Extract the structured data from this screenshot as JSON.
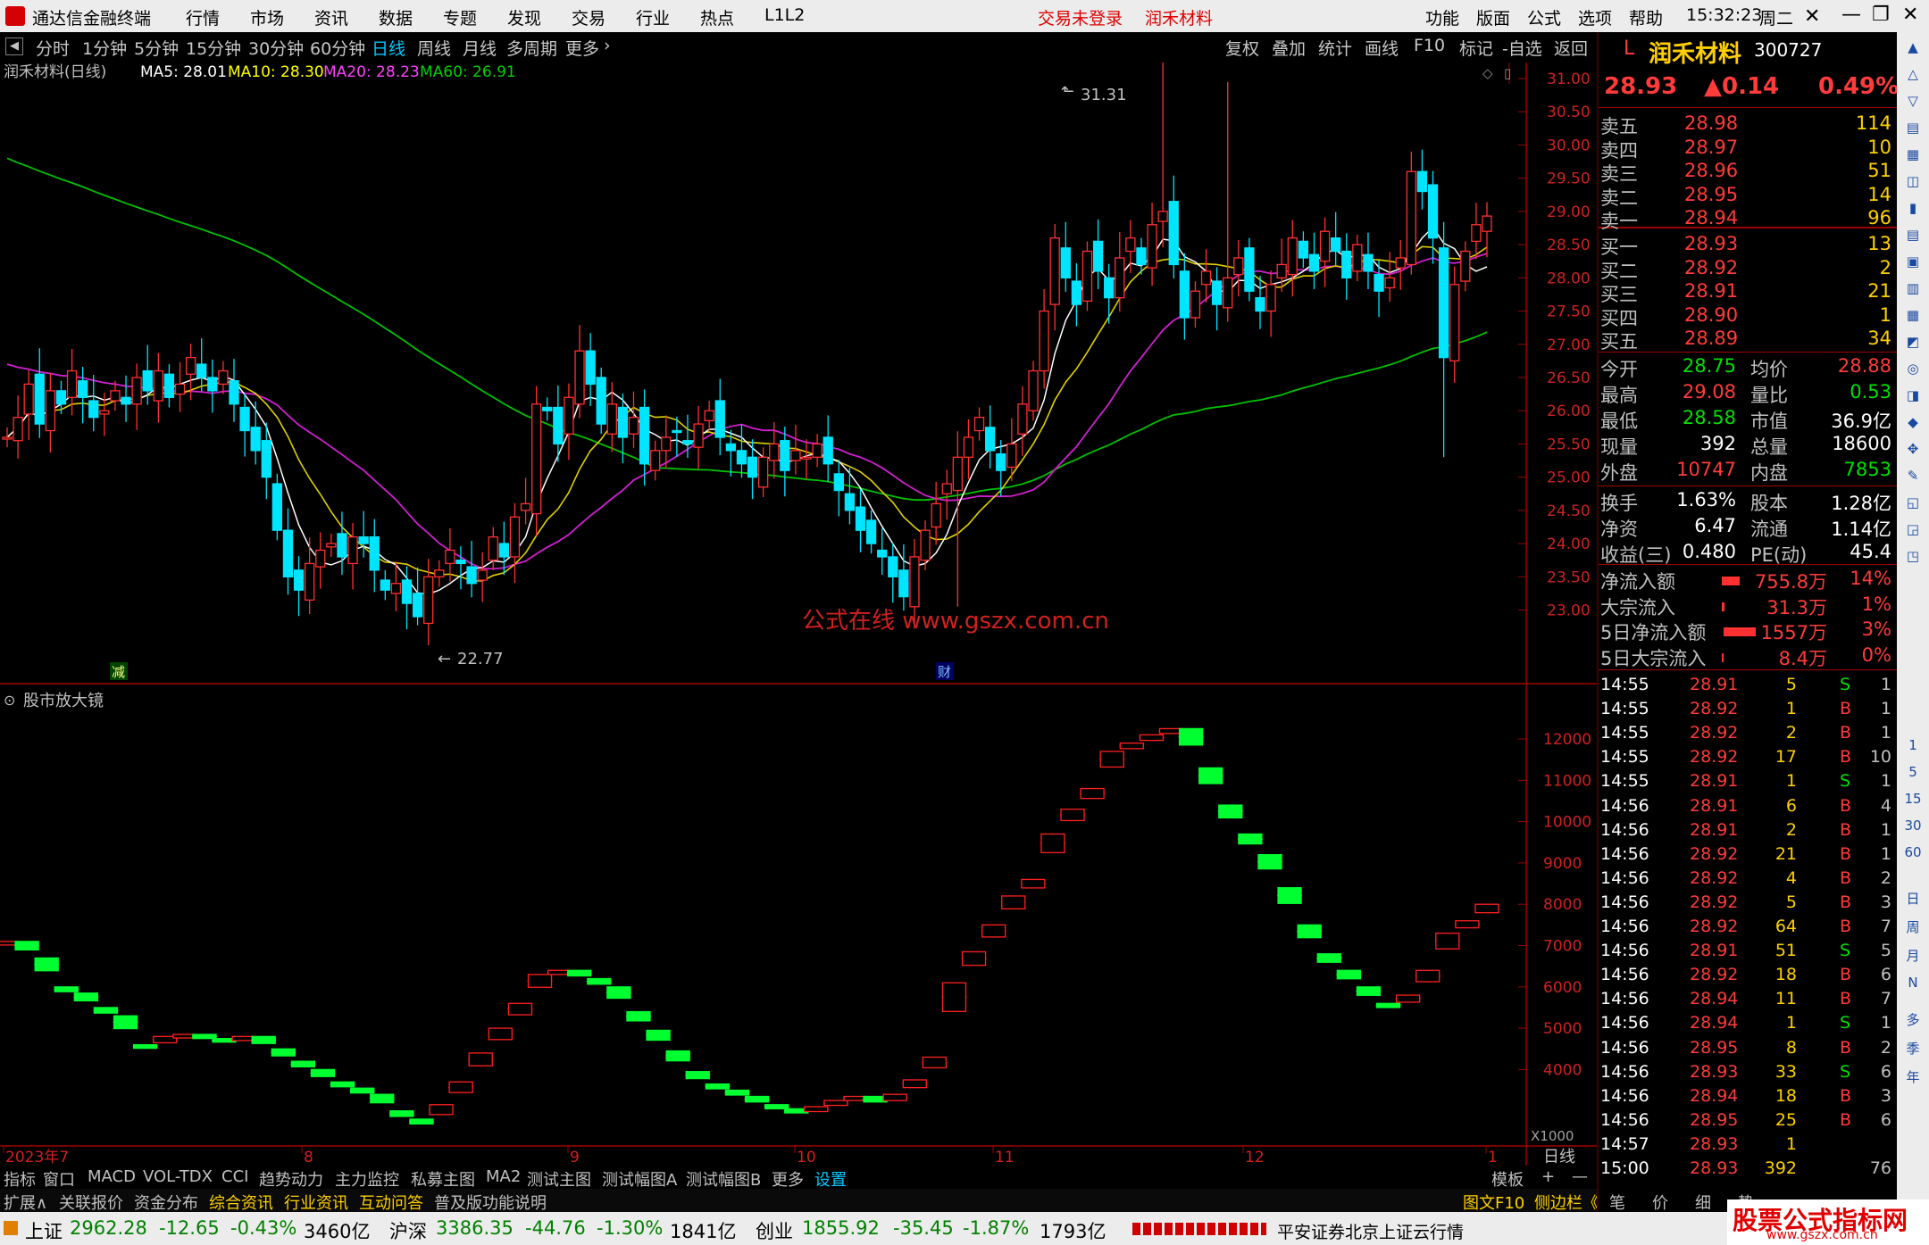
{
  "title": {
    "app": "通达信金融终端",
    "menus": [
      "行情",
      "市场",
      "资讯",
      "数据",
      "专题",
      "发现",
      "交易",
      "行业",
      "热点",
      "L1L2"
    ],
    "status_not_logged": "交易未登录",
    "stock": "润禾材料",
    "right_menus": [
      "功能",
      "版面",
      "公式",
      "选项",
      "帮助"
    ],
    "time": "15:32:23",
    "weekday": "周二"
  },
  "periods": [
    "分时",
    "1分钟",
    "5分钟",
    "15分钟",
    "30分钟",
    "60分钟",
    "日线",
    "周线",
    "月线",
    "多周期",
    "更多"
  ],
  "chart_tools": [
    "复权",
    "叠加",
    "统计",
    "画线",
    "F10",
    "标记",
    "-自选",
    "返回"
  ],
  "main_legend": {
    "name": "润禾材料(日线)",
    "ma5": "MA5: 28.01",
    "ma10": "MA10: 28.30",
    "ma20": "MA20: 28.23",
    "ma60": "MA60: 26.91"
  },
  "price_axis": [
    "31.00",
    "30.50",
    "30.00",
    "29.50",
    "29.00",
    "28.50",
    "28.00",
    "27.50",
    "27.00",
    "26.50",
    "26.00",
    "25.50",
    "25.00",
    "24.50",
    "24.00",
    "23.50",
    "23.00"
  ],
  "annotations": {
    "high": "31.31",
    "low": "22.77",
    "watermark": "公式在线 www.gszx.com.cn",
    "mark1": "减",
    "mark2": "财"
  },
  "sub_title": "股市放大镜",
  "sub_axis": [
    "12000",
    "11000",
    "10000",
    "9000",
    "8000",
    "7000",
    "6000",
    "5000",
    "4000"
  ],
  "sub_unit": "X1000",
  "date_axis": [
    "2023年7",
    "8",
    "9",
    "10",
    "11",
    "12",
    "1"
  ],
  "period_label": "日线",
  "chart_data": {
    "type": "candlestick",
    "series": [
      {
        "name": "润禾材料(日线)"
      }
    ],
    "ylim": [
      22.77,
      31.31
    ]
  },
  "bottom_tabs": [
    "指标",
    "窗口",
    "MACD",
    "VOL-TDX",
    "CCI",
    "趋势动力",
    "主力监控",
    "私募主图",
    "MA2",
    "测试主图",
    "测试幅图A",
    "测试幅图B",
    "更多",
    "设置"
  ],
  "bottom_right": [
    "模板",
    "+",
    "—"
  ],
  "bottom2": [
    "扩展∧",
    "关联报价",
    "资金分布",
    "综合资讯",
    "行业资讯",
    "互动问答",
    "普及版功能说明"
  ],
  "bottom2_right": [
    "图文F10",
    "侧边栏《",
    "笔",
    "价",
    "细",
    "势"
  ],
  "quote": {
    "letter": "L",
    "name": "润禾材料",
    "code": "300727",
    "price": "28.93",
    "change": "▲0.14",
    "pct": "0.49%",
    "asks": [
      [
        "卖五",
        "28.98",
        "114"
      ],
      [
        "卖四",
        "28.97",
        "10"
      ],
      [
        "卖三",
        "28.96",
        "51"
      ],
      [
        "卖二",
        "28.95",
        "14"
      ],
      [
        "卖一",
        "28.94",
        "96"
      ]
    ],
    "bids": [
      [
        "买一",
        "28.93",
        "13"
      ],
      [
        "买二",
        "28.92",
        "2"
      ],
      [
        "买三",
        "28.91",
        "21"
      ],
      [
        "买四",
        "28.90",
        "1"
      ],
      [
        "买五",
        "28.89",
        "34"
      ]
    ],
    "stats": [
      [
        "今开",
        "28.75",
        "均价",
        "28.88"
      ],
      [
        "最高",
        "29.08",
        "量比",
        "0.53"
      ],
      [
        "最低",
        "28.58",
        "市值",
        "36.9亿"
      ],
      [
        "现量",
        "392",
        "总量",
        "18600"
      ],
      [
        "外盘",
        "10747",
        "内盘",
        "7853"
      ]
    ],
    "stats2": [
      [
        "换手",
        "1.63%",
        "股本",
        "1.28亿"
      ],
      [
        "净资",
        "6.47",
        "流通",
        "1.14亿"
      ],
      [
        "收益(三)",
        "0.480",
        "PE(动)",
        "45.4"
      ]
    ],
    "flows": [
      [
        "净流入额",
        "755.8万",
        "14%"
      ],
      [
        "大宗流入",
        "31.3万",
        "1%"
      ],
      [
        "5日净流入额",
        "1557万",
        "3%"
      ],
      [
        "5日大宗流入",
        "8.4万",
        "0%"
      ]
    ],
    "ticks": [
      [
        "14:55",
        "28.91",
        "5",
        "S",
        "1"
      ],
      [
        "14:55",
        "28.92",
        "1",
        "B",
        "1"
      ],
      [
        "14:55",
        "28.92",
        "2",
        "B",
        "1"
      ],
      [
        "14:55",
        "28.92",
        "17",
        "B",
        "10"
      ],
      [
        "14:55",
        "28.91",
        "1",
        "S",
        "1"
      ],
      [
        "14:56",
        "28.91",
        "6",
        "B",
        "4"
      ],
      [
        "14:56",
        "28.91",
        "2",
        "B",
        "1"
      ],
      [
        "14:56",
        "28.92",
        "21",
        "B",
        "1"
      ],
      [
        "14:56",
        "28.92",
        "4",
        "B",
        "2"
      ],
      [
        "14:56",
        "28.92",
        "5",
        "B",
        "3"
      ],
      [
        "14:56",
        "28.92",
        "64",
        "B",
        "7"
      ],
      [
        "14:56",
        "28.91",
        "51",
        "S",
        "5"
      ],
      [
        "14:56",
        "28.92",
        "18",
        "B",
        "6"
      ],
      [
        "14:56",
        "28.94",
        "11",
        "B",
        "7"
      ],
      [
        "14:56",
        "28.94",
        "1",
        "S",
        "1"
      ],
      [
        "14:56",
        "28.95",
        "8",
        "B",
        "2"
      ],
      [
        "14:56",
        "28.93",
        "33",
        "S",
        "6"
      ],
      [
        "14:56",
        "28.94",
        "18",
        "B",
        "3"
      ],
      [
        "14:56",
        "28.95",
        "25",
        "B",
        "6"
      ],
      [
        "14:57",
        "28.93",
        "1",
        "",
        ""
      ],
      [
        "15:00",
        "28.93",
        "392",
        "",
        "76"
      ]
    ]
  },
  "sidebar_labels": [
    "1",
    "5",
    "15",
    "30",
    "60",
    "日",
    "周",
    "月",
    "N",
    "多",
    "季",
    "年"
  ],
  "status": {
    "sh_name": "上证",
    "sh": "2962.28",
    "sh_chg": "-12.65",
    "sh_pct": "-0.43%",
    "sh_amt": "3460亿",
    "hs_name": "沪深",
    "hs": "3386.35",
    "hs_chg": "-44.76",
    "hs_pct": "-1.30%",
    "hs_amt": "1841亿",
    "cy_name": "创业",
    "cy": "1855.92",
    "cy_chg": "-35.45",
    "cy_pct": "-1.87%",
    "cy_amt": "1793亿",
    "server": "平安证券北京上证云行情",
    "brand": "股票公式指标网",
    "brand_url": "www.gszx.com.cn"
  }
}
